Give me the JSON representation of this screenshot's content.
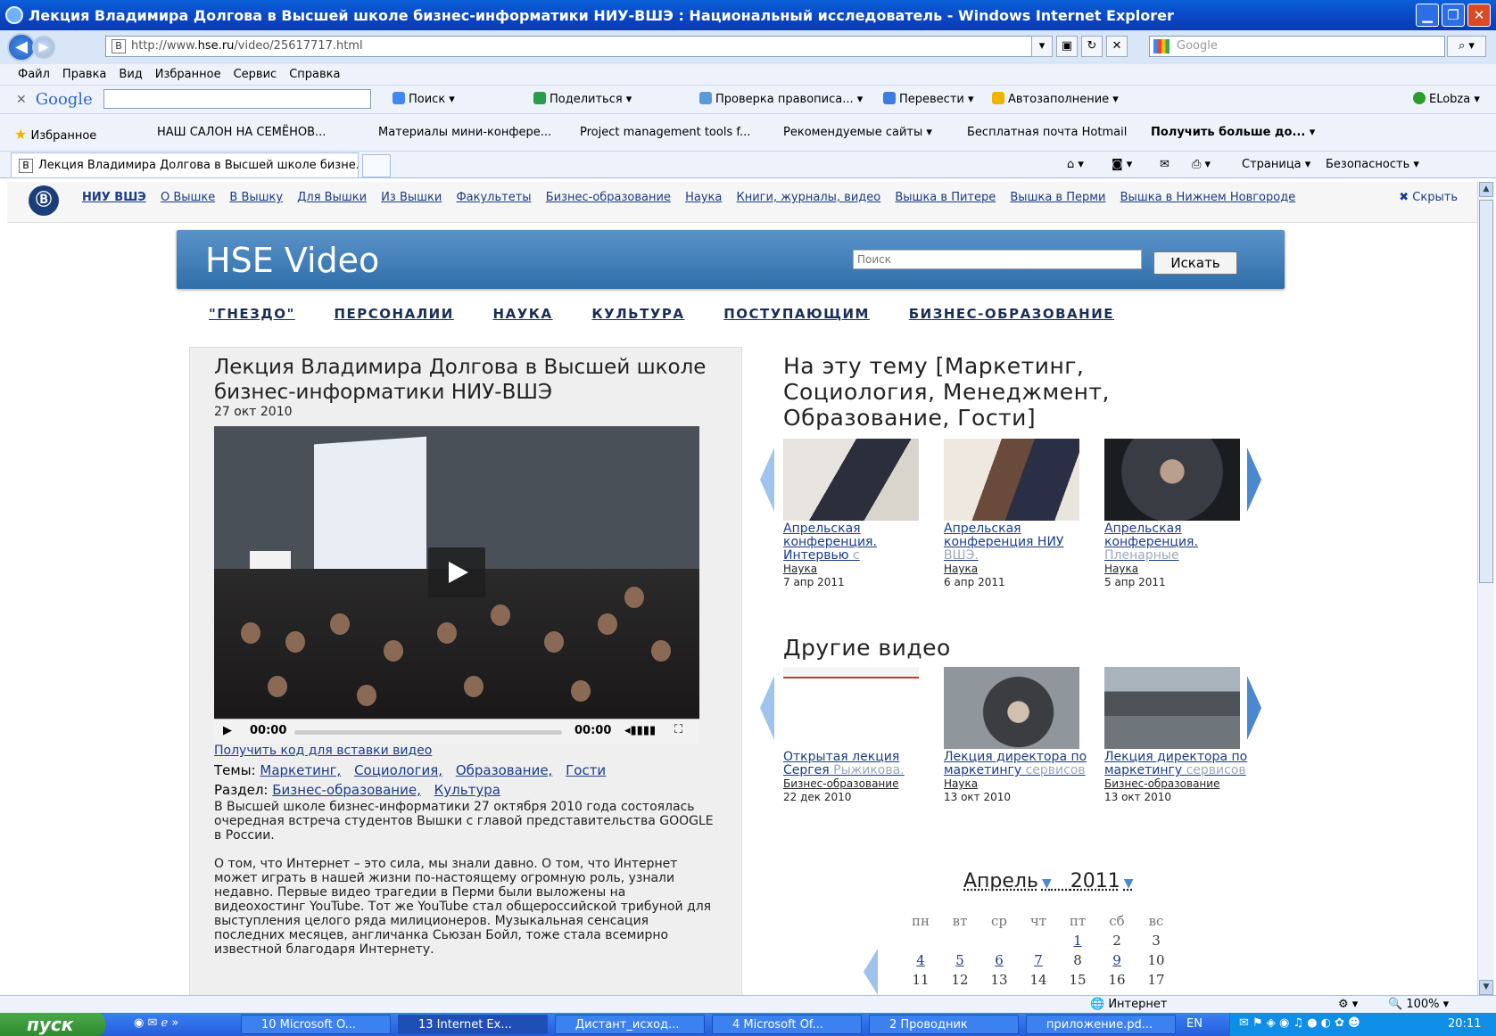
{
  "window": {
    "title": "Лекция Владимира Долгова в Высшей школе бизнес-информатики НИУ-ВШЭ : Национальный исследователь - Windows Internet Explorer"
  },
  "address": {
    "prefix": "http://www.",
    "domain": "hse.ru",
    "path": "/video/25617717.html",
    "search_placeholder": "Google"
  },
  "menu": [
    "Файл",
    "Правка",
    "Вид",
    "Избранное",
    "Сервис",
    "Справка"
  ],
  "google_toolbar": {
    "logo": "Google",
    "search": "Поиск ▾",
    "share": "Поделиться ▾",
    "spell": "Проверка правописа... ▾",
    "translate": "Перевести ▾",
    "autofill": "Автозаполнение ▾",
    "user": "ELobza ▾"
  },
  "favorites": {
    "label": "Избранное",
    "items": [
      "НАШ САЛОН НА СЕМЁНОВ...",
      "Материалы мини-конфере...",
      "Project management tools f...",
      "Рекомендуемые сайты ▾",
      "Бесплатная почта Hotmail",
      "Получить больше до... ▾"
    ]
  },
  "tab": {
    "title": "Лекция Владимира Долгова в Высшей школе бизне..."
  },
  "commands": {
    "page": "Страница ▾",
    "safety": "Безопасность ▾"
  },
  "hse_nav": {
    "logo": "Ⓑ",
    "items": [
      "НИУ ВШЭ",
      "О Вышке",
      "В Вышку",
      "Для Вышки",
      "Из Вышки",
      "Факультеты",
      "Бизнес-образование",
      "Наука",
      "Книги, журналы, видео",
      "Вышка в Питере",
      "Вышка в Перми",
      "Вышка в Нижнем Новгороде"
    ],
    "hide": "✖ Скрыть"
  },
  "video_header": {
    "title": "HSE Video",
    "search_placeholder": "Поиск",
    "search_button": "Искать"
  },
  "categories": [
    "\"ГНЕЗДО\"",
    "ПЕРСОНАЛИИ",
    "НАУКА",
    "КУЛЬТУРА",
    "ПОСТУПАЮЩИМ",
    "БИЗНЕС-ОБРАЗОВАНИЕ"
  ],
  "article": {
    "title": "Лекция Владимира Долгова в Высшей школе бизнес-информатики НИУ-ВШЭ",
    "date": "27 окт 2010",
    "player": {
      "time_current": "00:00",
      "time_total": "00:00"
    },
    "get_code": "Получить код для вставки видео",
    "themes_label": "Темы:",
    "themes": [
      "Маркетинг,",
      "Социология,",
      "Образование,",
      "Гости"
    ],
    "section_label": "Раздел:",
    "sections": [
      "Бизнес-образование,",
      "Культура"
    ],
    "paragraph1": "В Высшей школе бизнес-информатики 27 октября 2010 года состоялась очередная встреча студентов Вышки с главой представительства GOOGLE в России.",
    "paragraph2": "О том, что Интернет – это сила, мы знали давно. О том, что Интернет может играть в нашей жизни по-настоящему огромную роль, узнали недавно. Первые видео трагедии в Перми были выложены на видеохостинг YouTube. Тот же YouTube стал общероссийской трибуной для выступления целого ряда милиционеров. Музыкальная сенсация последних месяцев, англичанка Сьюзан Бойл, тоже стала всемирно известной благодаря Интернету."
  },
  "related": {
    "title": "На эту тему [Маркетинг, Социология, Менеджмент, Образование, Гости]",
    "items": [
      {
        "caption": "Апрельская конференция. Интервью ",
        "fade": "с",
        "section": "Наука",
        "date": "7 апр 2011"
      },
      {
        "caption": "Апрельская конференция НИУ ",
        "fade": "ВШЭ.",
        "section": "Наука",
        "date": "6 апр 2011"
      },
      {
        "caption": "Апрельская конференция. ",
        "fade": "Пленарные",
        "section": "Наука",
        "date": "5 апр 2011"
      }
    ]
  },
  "other": {
    "title": "Другие видео",
    "items": [
      {
        "caption": "Открытая лекция Сергея ",
        "fade": "Рыжикова.",
        "section": "Бизнес-образование",
        "date": "22 дек 2010"
      },
      {
        "caption": "Лекция директора по маркетингу ",
        "fade": "сервисов",
        "section": "Наука",
        "date": "13 окт 2010"
      },
      {
        "caption": "Лекция директора по маркетингу ",
        "fade": "сервисов",
        "section": "Бизнес-образование",
        "date": "13 окт 2010"
      }
    ]
  },
  "calendar": {
    "month": "Апрель",
    "year": "2011",
    "days": [
      "пн",
      "вт",
      "ср",
      "чт",
      "пт",
      "сб",
      "вс"
    ],
    "row1": [
      "",
      "",
      "",
      "",
      "1",
      "2",
      "3"
    ],
    "row2": [
      "4",
      "5",
      "6",
      "7",
      "8",
      "9",
      "10"
    ],
    "row3": [
      "11",
      "12",
      "13",
      "14",
      "15",
      "16",
      "17"
    ]
  },
  "status": {
    "zone": "Интернет",
    "zoom": "100%"
  },
  "taskbar": {
    "start": "пуск",
    "tasks": [
      "10 Microsoft O...",
      "13 Internet Ex...",
      "Дистант_исход...",
      "4 Microsoft Of...",
      "2 Проводник",
      "приложение.pd..."
    ],
    "lang": "EN",
    "clock": "20:11"
  }
}
